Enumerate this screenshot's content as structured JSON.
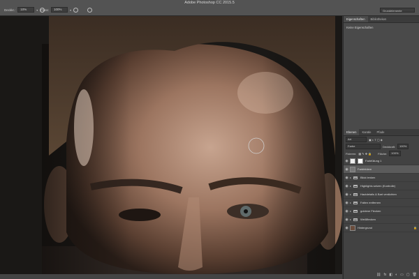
{
  "app": {
    "title": "Adobe Photoshop CC 2015.5",
    "workspace": "Grundelemente"
  },
  "options_bar": {
    "deckraft_label": "Deckkr.:",
    "deckraft_value": "10%",
    "fluss_label": "Fluss:",
    "fluss_value": "100%"
  },
  "panels": {
    "tabs": [
      {
        "label": "Eigenschaften"
      },
      {
        "label": "Bibliotheken"
      }
    ],
    "properties_text": "Keine Eigenschaften",
    "layer_tabs": [
      {
        "label": "Ebenen"
      },
      {
        "label": "Kanäle"
      },
      {
        "label": "Pfade"
      }
    ],
    "filter": "Art",
    "blend_mode": "Farbe",
    "opacity_label": "Deckkraft:",
    "opacity_value": "100%",
    "lock_label": "Fixieren:",
    "fill_label": "Fläche:",
    "fill_value": "100%"
  },
  "layers": [
    {
      "name": "Farbfüllung 1",
      "kind": "adjustment"
    },
    {
      "name": "Farbfeldem",
      "kind": "layer",
      "selected": true
    },
    {
      "name": "Blick lenken",
      "kind": "group"
    },
    {
      "name": "Highlights setzen (Kontrolle)",
      "kind": "group"
    },
    {
      "name": "Hautdetails & Bart verdichten",
      "kind": "group"
    },
    {
      "name": "Falten entfernen",
      "kind": "group"
    },
    {
      "name": "goldene Flecken",
      "kind": "group"
    },
    {
      "name": "Weißflecken",
      "kind": "group"
    },
    {
      "name": "Hintergrund",
      "kind": "background"
    }
  ],
  "colors": {
    "panel_bg": "#464646",
    "selected_row": "#5b5b5b"
  }
}
